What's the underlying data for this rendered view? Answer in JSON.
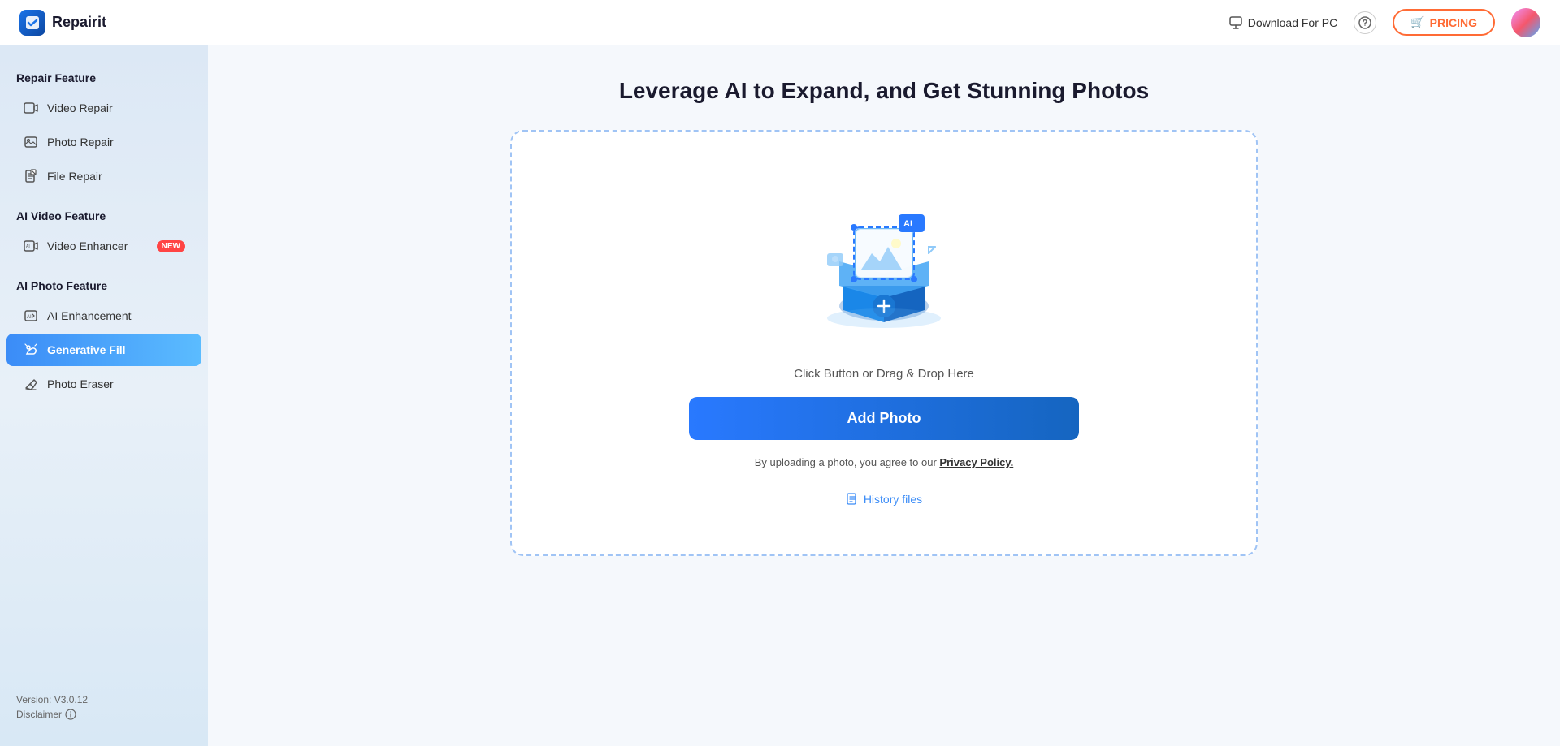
{
  "header": {
    "logo_text": "Repairit",
    "download_label": "Download For PC",
    "pricing_label": "PRICING",
    "pricing_icon": "🛒"
  },
  "sidebar": {
    "sections": [
      {
        "id": "repair-feature",
        "label": "Repair Feature",
        "items": [
          {
            "id": "video-repair",
            "label": "Video Repair",
            "active": false
          },
          {
            "id": "photo-repair",
            "label": "Photo Repair",
            "active": false
          },
          {
            "id": "file-repair",
            "label": "File Repair",
            "active": false
          }
        ]
      },
      {
        "id": "ai-video-feature",
        "label": "AI Video Feature",
        "items": [
          {
            "id": "video-enhancer",
            "label": "Video Enhancer",
            "active": false,
            "badge": "NEW"
          }
        ]
      },
      {
        "id": "ai-photo-feature",
        "label": "AI Photo Feature",
        "items": [
          {
            "id": "ai-enhancement",
            "label": "AI Enhancement",
            "active": false
          },
          {
            "id": "generative-fill",
            "label": "Generative Fill",
            "active": true
          },
          {
            "id": "photo-eraser",
            "label": "Photo Eraser",
            "active": false
          }
        ]
      }
    ],
    "version": "Version: V3.0.12",
    "disclaimer": "Disclaimer"
  },
  "main": {
    "title": "Leverage AI to Expand, and Get Stunning Photos",
    "upload_hint": "Click Button or Drag & Drop Here",
    "add_photo_label": "Add Photo",
    "privacy_text": "By uploading a photo, you agree to our",
    "privacy_link": "Privacy Policy.",
    "history_label": "History files"
  }
}
